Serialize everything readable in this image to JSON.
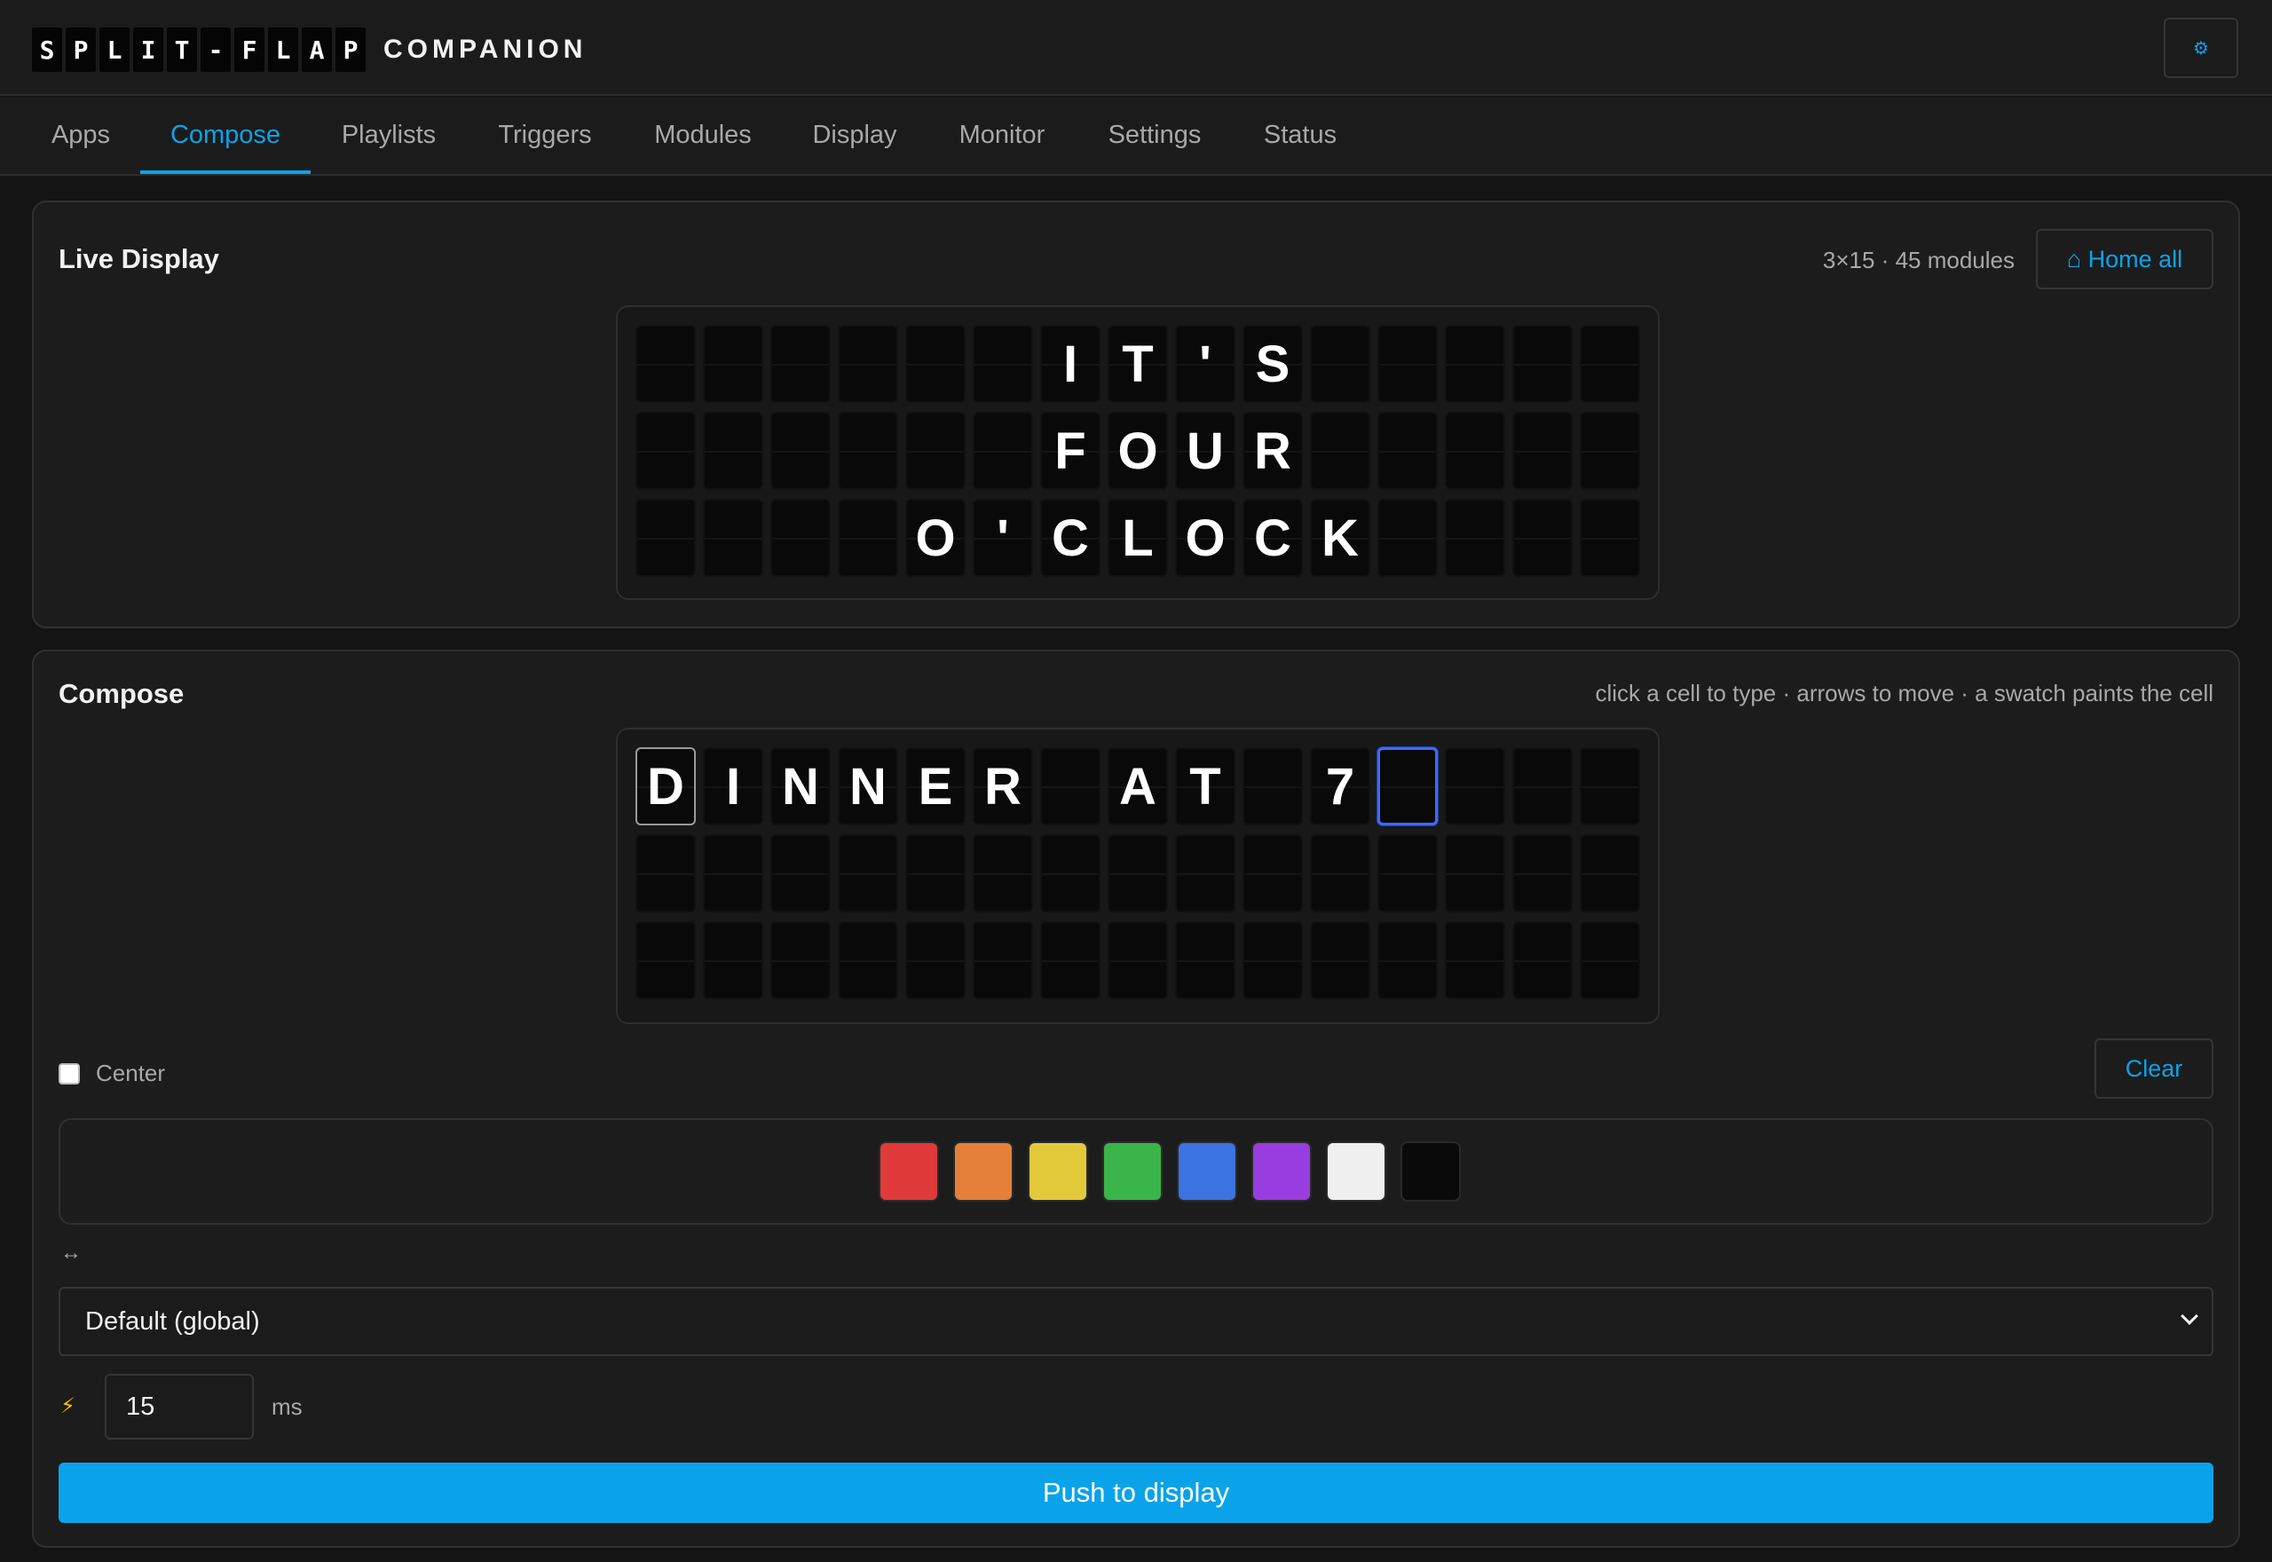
{
  "header": {
    "logo_letters": [
      "S",
      "P",
      "L",
      "I",
      "T",
      "-",
      "F",
      "L",
      "A",
      "P"
    ],
    "logo_word": "COMPANION",
    "settings_icon": "gear-icon",
    "settings_glyph": "⚙"
  },
  "tabs": [
    {
      "label": "Apps",
      "active": false
    },
    {
      "label": "Compose",
      "active": true
    },
    {
      "label": "Playlists",
      "active": false
    },
    {
      "label": "Triggers",
      "active": false
    },
    {
      "label": "Modules",
      "active": false
    },
    {
      "label": "Display",
      "active": false
    },
    {
      "label": "Monitor",
      "active": false
    },
    {
      "label": "Settings",
      "active": false
    },
    {
      "label": "Status",
      "active": false
    }
  ],
  "live_display": {
    "title": "Live Display",
    "meta": "3×15 · 45 modules",
    "home_all_label": "⌂ Home all",
    "rows": [
      [
        "",
        "",
        "",
        "",
        "",
        "",
        "I",
        "T",
        "'",
        "S",
        "",
        "",
        "",
        "",
        ""
      ],
      [
        "",
        "",
        "",
        "",
        "",
        "",
        "F",
        "O",
        "U",
        "R",
        "",
        "",
        "",
        "",
        ""
      ],
      [
        "",
        "",
        "",
        "",
        "O",
        "'",
        "C",
        "L",
        "O",
        "C",
        "K",
        "",
        "",
        "",
        ""
      ]
    ]
  },
  "compose": {
    "title": "Compose",
    "hint": "click a cell to type · arrows to move · a swatch paints the cell",
    "rows": [
      [
        "D",
        "I",
        "N",
        "N",
        "E",
        "R",
        "",
        "A",
        "T",
        "",
        "7",
        "",
        "",
        "",
        ""
      ],
      [
        "",
        "",
        "",
        "",
        "",
        "",
        "",
        "",
        "",
        "",
        "",
        "",
        "",
        "",
        ""
      ],
      [
        "",
        "",
        "",
        "",
        "",
        "",
        "",
        "",
        "",
        "",
        "",
        "",
        "",
        "",
        ""
      ]
    ],
    "cursor": {
      "row": 0,
      "col": 11
    },
    "center_label": "Center",
    "center_checked": false,
    "clear_label": "Clear",
    "swatches": [
      "#e03a3a",
      "#e5803a",
      "#e2c93a",
      "#3ab54a",
      "#3b73e0",
      "#9a3de0",
      "#f0f0f0",
      "#0a0a0a"
    ],
    "direction_icon": "↔",
    "animation_select": "Default (global)",
    "speed_icon": "⚡",
    "speed_value": "15",
    "speed_unit": "ms",
    "push_label": "Push to display"
  },
  "colors": {
    "accent": "#0aa3ea",
    "cursor": "#3b6bff"
  }
}
